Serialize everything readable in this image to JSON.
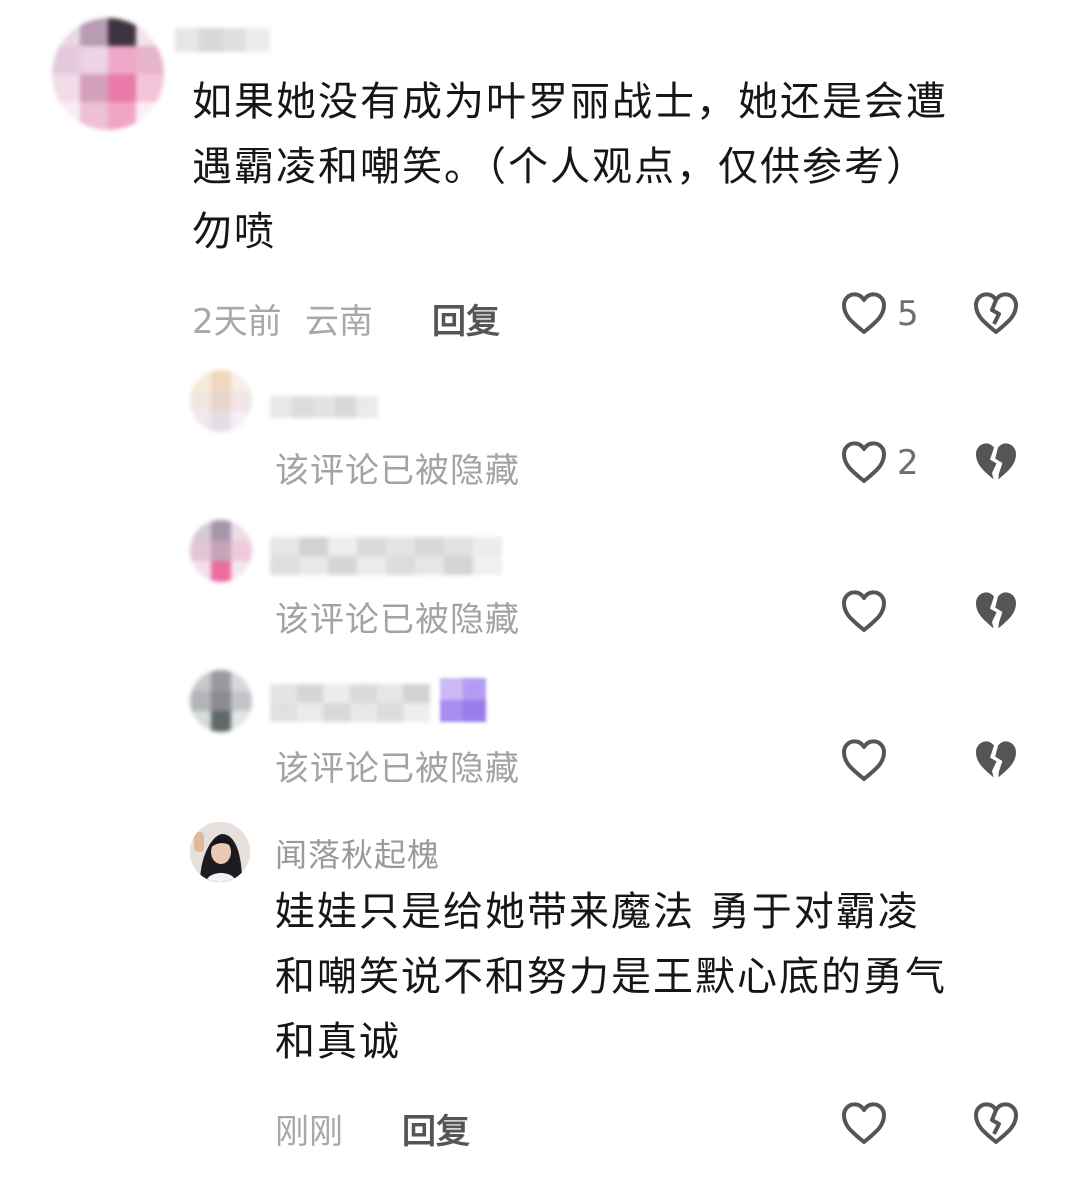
{
  "comments": [
    {
      "text_line1": "如果她没有成为叶罗丽战士，她还是会遭",
      "text_line2": "遇霸凌和嘲笑。（个人观点，仅供参考）",
      "text_line3": "勿喷",
      "time": "2天前",
      "location": "云南",
      "reply_label": "回复",
      "like_count": "5"
    }
  ],
  "replies": [
    {
      "text": "该评论已被隐藏",
      "like_count": "2"
    },
    {
      "text": "该评论已被隐藏",
      "like_count": ""
    },
    {
      "text": "该评论已被隐藏",
      "like_count": ""
    },
    {
      "username": "闻落秋起槐",
      "text_line1": "娃娃只是给她带来魔法 勇于对霸凌",
      "text_line2": "和嘲笑说不和努力是王默心底的勇气",
      "text_line3": "和真诚",
      "time": "刚刚",
      "reply_label": "回复"
    }
  ],
  "icons": {
    "like": "heart-outline-icon",
    "dislike_outline": "broken-heart-outline-icon",
    "dislike_filled": "broken-heart-filled-icon"
  },
  "colors": {
    "text_primary": "#161616",
    "text_muted": "#a3a3a3",
    "icon": "#555555"
  }
}
